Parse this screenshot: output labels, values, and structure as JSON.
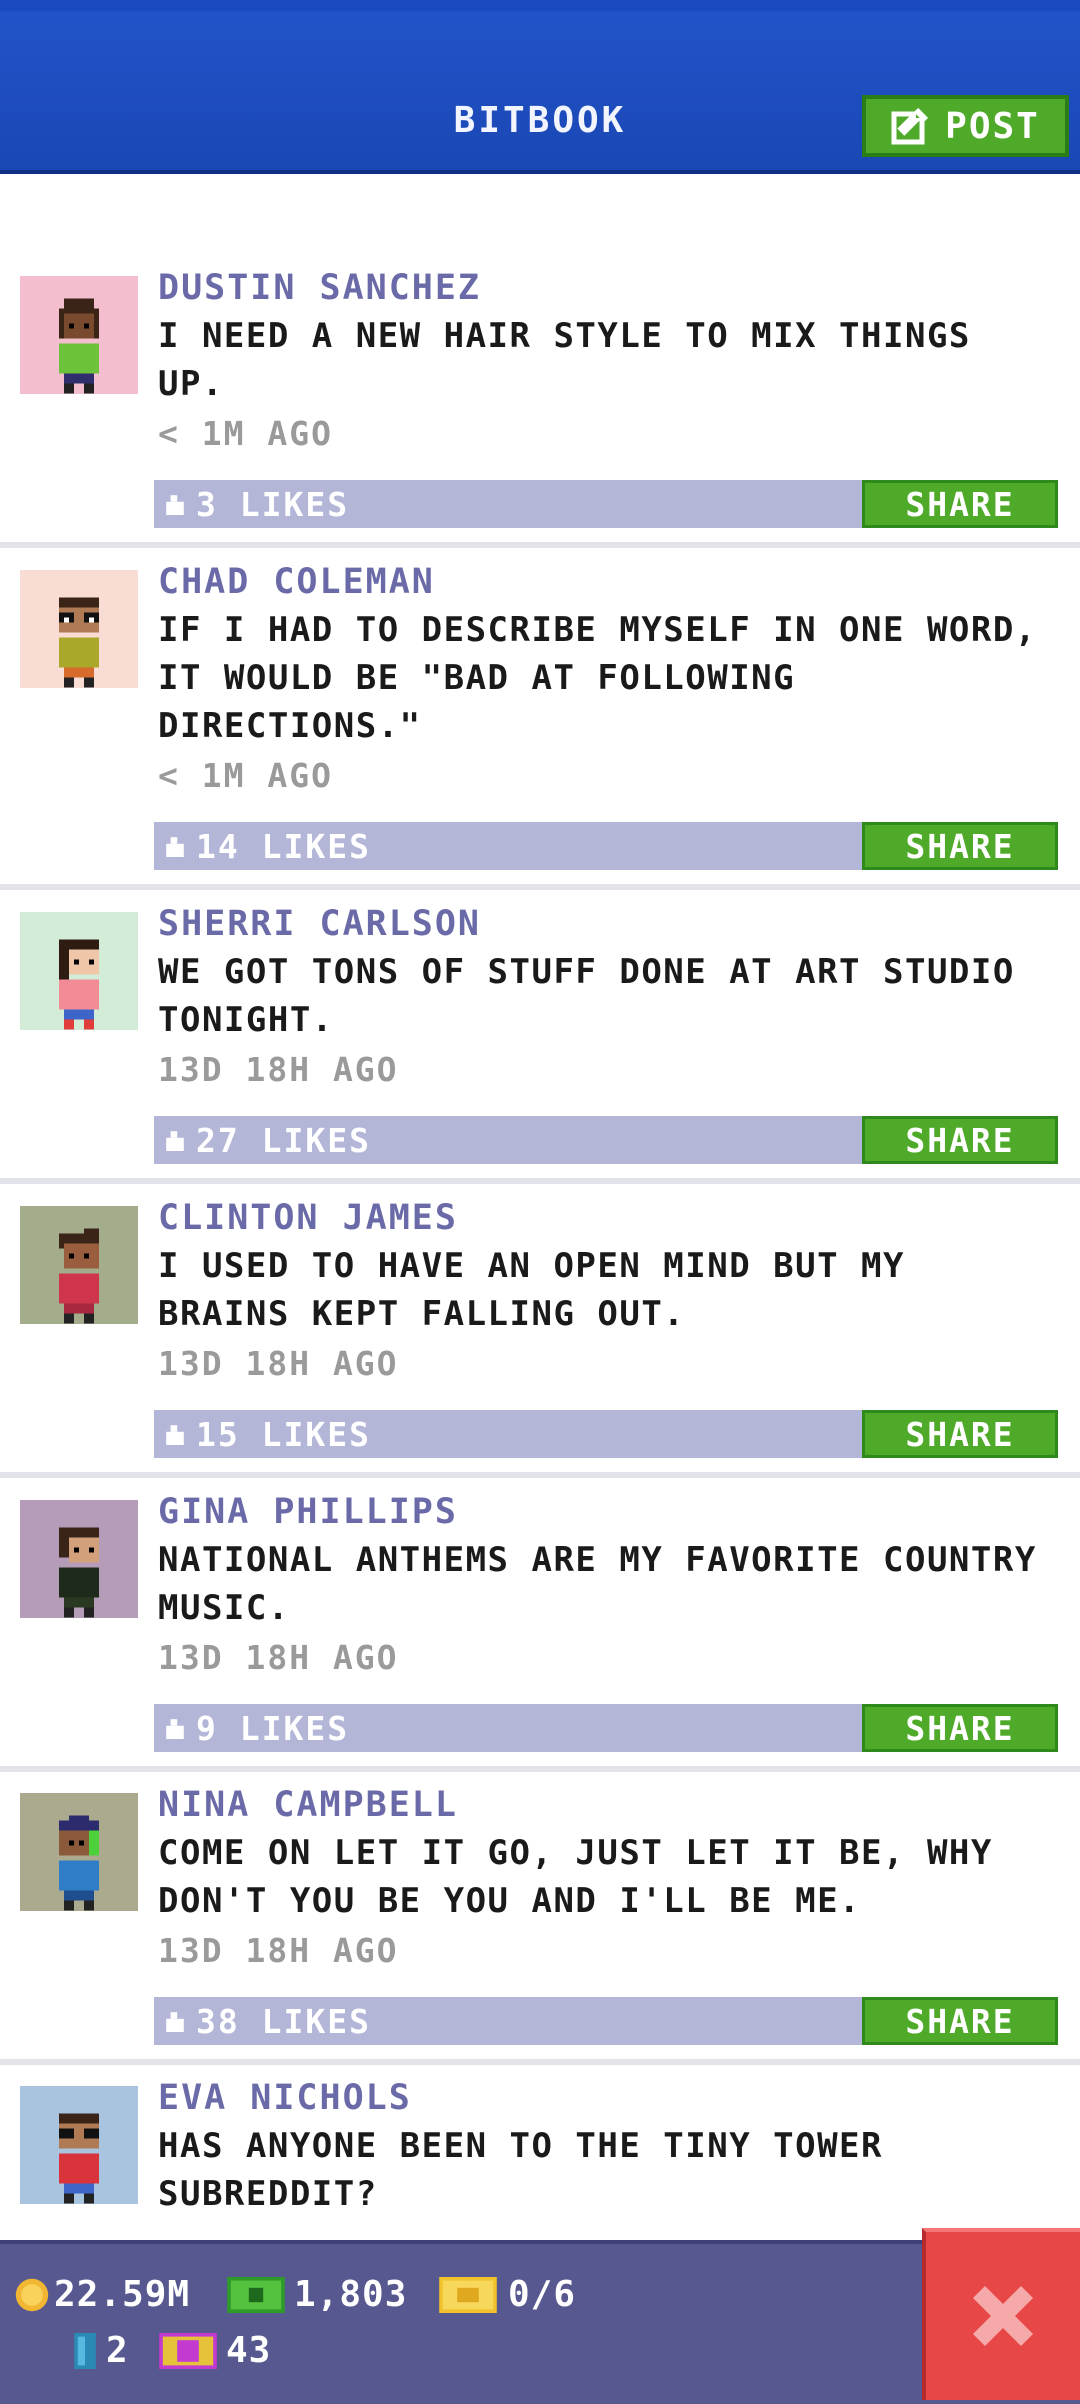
{
  "header": {
    "title": "BITBOOK",
    "post_label": "POST"
  },
  "posts": [
    {
      "name": "DUSTIN SANCHEZ",
      "text": "I need a new hair style to mix things up.",
      "time": "< 1M AGO",
      "likes": "3 LIKES",
      "share": "SHARE"
    },
    {
      "name": "CHAD COLEMAN",
      "text": "If I had to describe myself in one word, it would be \"bad at following directions.\"",
      "time": "< 1M AGO",
      "likes": "14 LIKES",
      "share": "SHARE"
    },
    {
      "name": "SHERRI CARLSON",
      "text": "We got tons of stuff done at art studio tonight.",
      "time": "13D 18H AGO",
      "likes": "27 LIKES",
      "share": "SHARE"
    },
    {
      "name": "CLINTON JAMES",
      "text": "I used to have an open mind but my brains kept falling out.",
      "time": "13D 18H AGO",
      "likes": "15 LIKES",
      "share": "SHARE"
    },
    {
      "name": "GINA PHILLIPS",
      "text": "National anthems are my favorite country music.",
      "time": "13D 18H AGO",
      "likes": "9 LIKES",
      "share": "SHARE"
    },
    {
      "name": "NINA CAMPBELL",
      "text": "Come on let it go, just let it be, why don't you be you and I'll be me.",
      "time": "13D 18H AGO",
      "likes": "38 LIKES",
      "share": "SHARE"
    },
    {
      "name": "EVA NICHOLS",
      "text": "Has anyone been to the Tiny Tower subreddit?",
      "time": "",
      "likes": "",
      "share": ""
    }
  ],
  "footer": {
    "coins": "22.59M",
    "bux": "1,803",
    "tickets": "0/6",
    "keys": "2",
    "gems": "43"
  },
  "colors": {
    "header": "#1a47b4",
    "share_green": "#4faa2a",
    "like_bar": "#b4b6d8",
    "footer": "#56588f",
    "close_red": "#e84747"
  }
}
